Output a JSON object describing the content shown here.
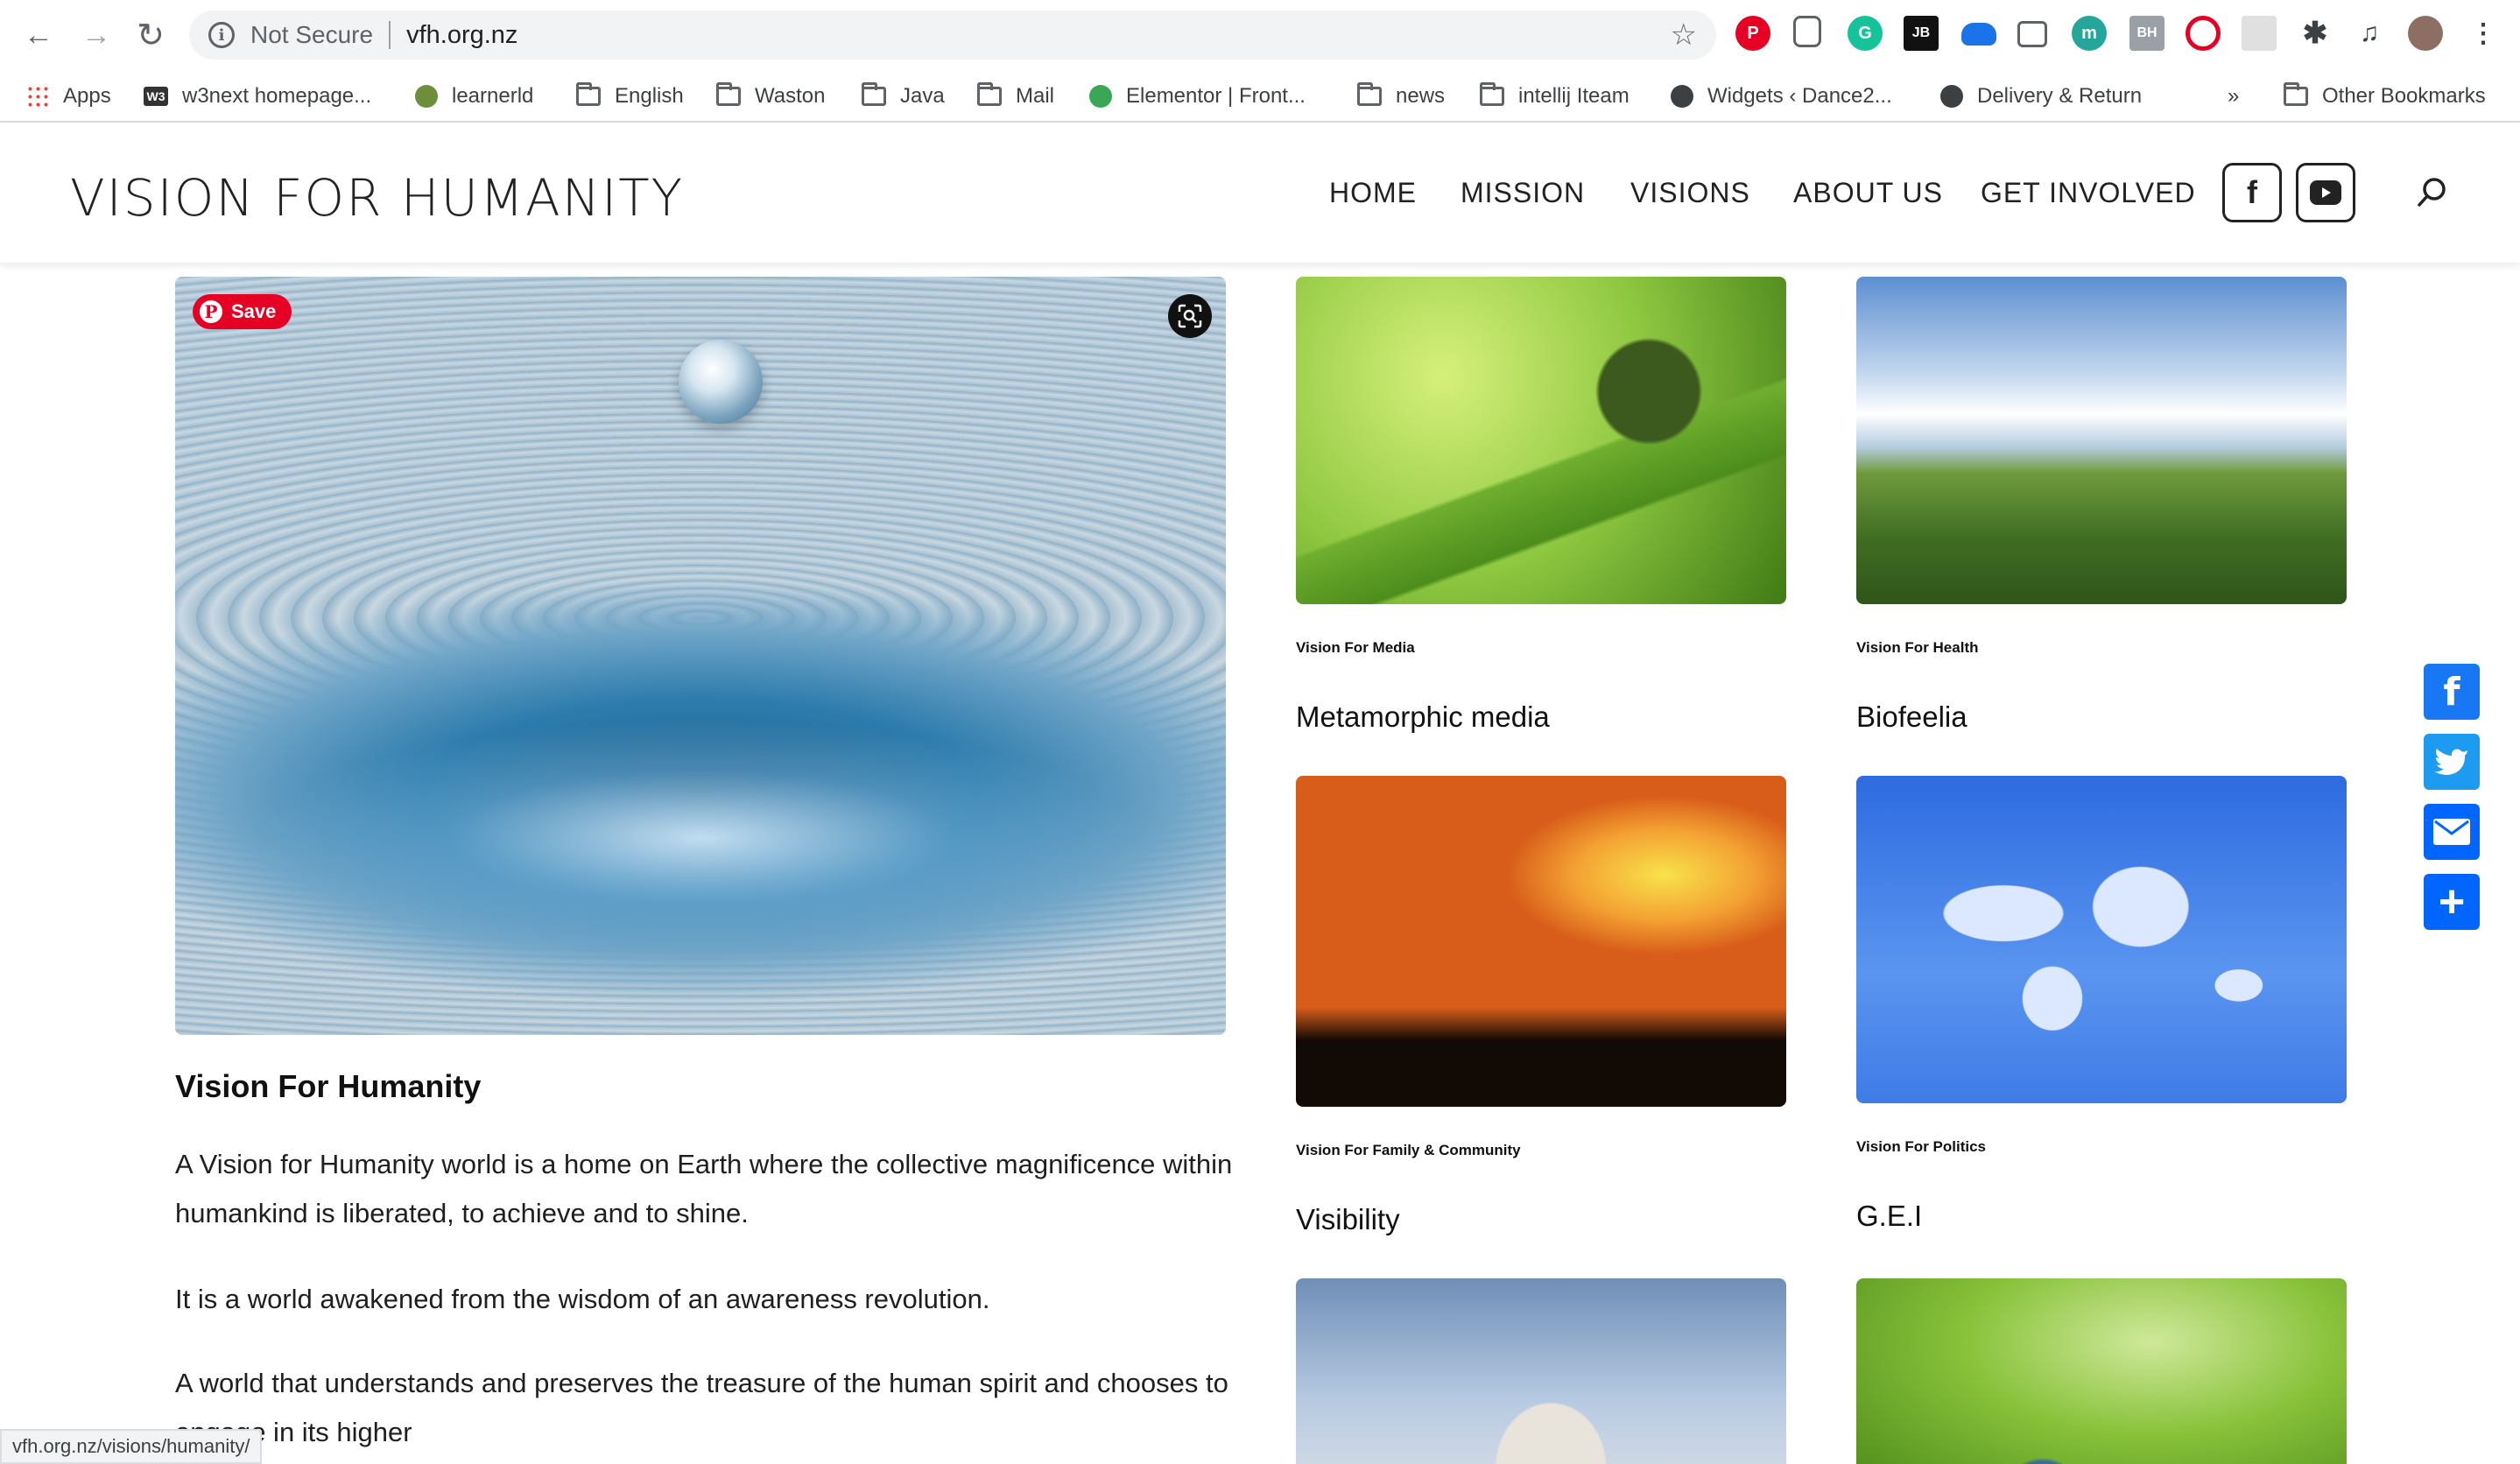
{
  "browser": {
    "security_label": "Not Secure",
    "url": "vfh.org.nz",
    "status_url": "vfh.org.nz/visions/humanity/",
    "extensions": [
      "JB",
      "m",
      "BH"
    ]
  },
  "bookmarks": {
    "items": [
      "Apps",
      "w3next homepage...",
      "learnerld",
      "English",
      "Waston",
      "Java",
      "Mail",
      "Elementor | Front...",
      "news",
      "intellij Iteam",
      "Widgets ‹ Dance2...",
      "Delivery & Return"
    ],
    "overflow": "»",
    "other": "Other Bookmarks",
    "w3_badge": "W3"
  },
  "site": {
    "logo": "VISION FOR HUMANITY",
    "nav": [
      "HOME",
      "MISSION",
      "VISIONS",
      "ABOUT US",
      "GET INVOLVED"
    ]
  },
  "hero": {
    "pin_label": "Save",
    "pin_letter": "P"
  },
  "article": {
    "title": "Vision For Humanity",
    "paragraphs": [
      "A Vision for Humanity world is a home on Earth where the collective magnificence within humankind is liberated, to achieve and to shine.",
      "It is a world awakened from the wisdom of an awareness revolution.",
      "A world that understands and preserves the treasure of the human spirit and chooses to engage in its higher"
    ]
  },
  "cards": [
    {
      "category": "Vision For Media",
      "title": "Metamorphic media"
    },
    {
      "category": "Vision For Health",
      "title": "Biofeelia"
    },
    {
      "category": "Vision For Family & Community",
      "title": "Visibility"
    },
    {
      "category": "Vision For Politics",
      "title": "G.E.I"
    }
  ],
  "share_icons": [
    "facebook-share",
    "twitter-share",
    "email-share",
    "add-share"
  ],
  "colors": {
    "pinterest": "#e60023",
    "facebook": "#1877f2",
    "twitter": "#1d9bf0",
    "share_blue": "#0166ff"
  }
}
